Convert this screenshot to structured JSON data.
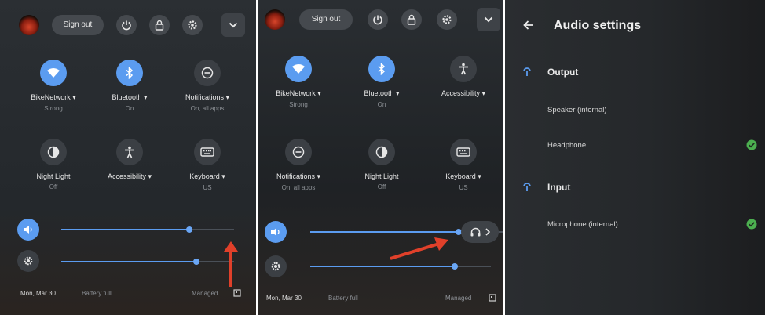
{
  "panel1": {
    "signout_label": "Sign out",
    "tiles": [
      {
        "label": "BikeNetwork",
        "sub": "Strong",
        "icon": "wifi-icon",
        "active": true
      },
      {
        "label": "Bluetooth",
        "sub": "On",
        "icon": "bluetooth-icon",
        "active": true
      },
      {
        "label": "Notifications",
        "sub": "On, all apps",
        "icon": "do-not-disturb-icon",
        "active": false
      },
      {
        "label": "Night Light",
        "sub": "Off",
        "icon": "night-light-icon",
        "active": false
      },
      {
        "label": "Accessibility",
        "sub": "",
        "icon": "accessibility-icon",
        "active": false
      },
      {
        "label": "Keyboard",
        "sub": "US",
        "icon": "keyboard-icon",
        "active": false
      }
    ],
    "volume_level": 0.74,
    "brightness_level": 0.78,
    "date": "Mon, Mar 30",
    "battery": "Battery full",
    "managed": "Managed"
  },
  "panel2": {
    "signout_label": "Sign out",
    "tiles": [
      {
        "label": "BikeNetwork",
        "sub": "Strong",
        "icon": "wifi-icon",
        "active": true
      },
      {
        "label": "Bluetooth",
        "sub": "On",
        "icon": "bluetooth-icon",
        "active": true
      },
      {
        "label": "Accessibility",
        "sub": "",
        "icon": "accessibility-icon",
        "active": false
      },
      {
        "label": "Notifications",
        "sub": "On, all apps",
        "icon": "do-not-disturb-icon",
        "active": false
      },
      {
        "label": "Night Light",
        "sub": "Off",
        "icon": "night-light-icon",
        "active": false
      },
      {
        "label": "Keyboard",
        "sub": "US",
        "icon": "keyboard-icon",
        "active": false
      }
    ],
    "volume_level": 0.74,
    "brightness_level": 0.8,
    "date": "Mon, Mar 30",
    "battery": "Battery full",
    "managed": "Managed"
  },
  "panel3": {
    "title": "Audio settings",
    "output_heading": "Output",
    "output_devices": [
      {
        "name": "Speaker (internal)",
        "selected": false
      },
      {
        "name": "Headphone",
        "selected": true
      }
    ],
    "input_heading": "Input",
    "input_devices": [
      {
        "name": "Microphone (internal)",
        "selected": true
      }
    ]
  },
  "colors": {
    "accent": "#5b9cf0",
    "check": "#4caf50",
    "arrow": "#e0402a"
  }
}
